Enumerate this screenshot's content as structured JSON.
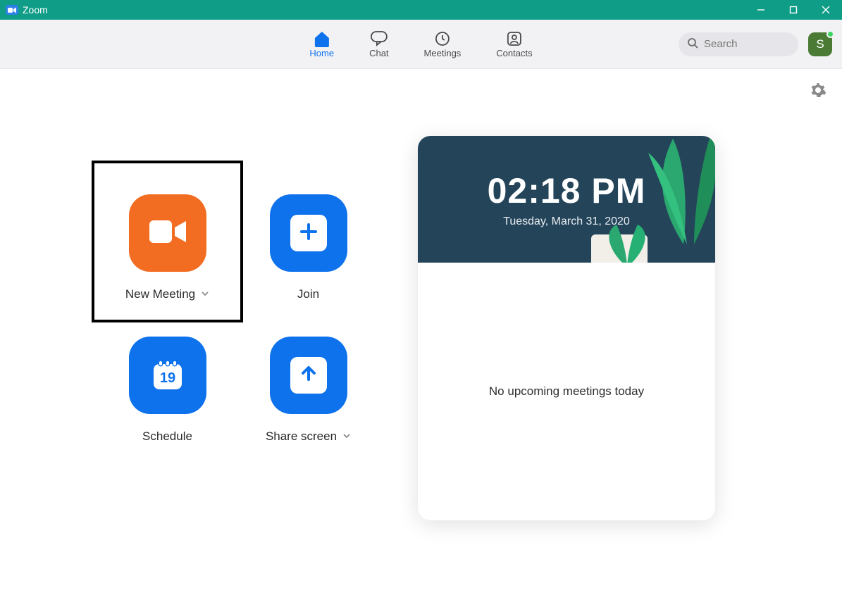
{
  "window": {
    "title": "Zoom"
  },
  "tabs": [
    {
      "label": "Home"
    },
    {
      "label": "Chat"
    },
    {
      "label": "Meetings"
    },
    {
      "label": "Contacts"
    }
  ],
  "search": {
    "placeholder": "Search"
  },
  "avatar": {
    "initial": "S"
  },
  "actions": {
    "newMeeting": {
      "label": "New Meeting"
    },
    "join": {
      "label": "Join"
    },
    "schedule": {
      "label": "Schedule",
      "dayNumber": "19"
    },
    "shareScreen": {
      "label": "Share screen"
    }
  },
  "card": {
    "time": "02:18 PM",
    "date": "Tuesday, March 31, 2020",
    "empty": "No upcoming meetings today"
  }
}
